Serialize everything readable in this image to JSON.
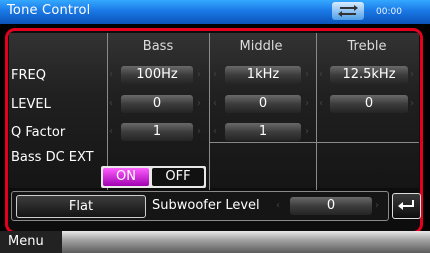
{
  "window": {
    "title": "Tone Control",
    "clock": "00:00"
  },
  "columns": [
    "Bass",
    "Middle",
    "Treble"
  ],
  "rows": [
    {
      "label": "FREQ",
      "values": [
        "100Hz",
        "1kHz",
        "12.5kHz"
      ]
    },
    {
      "label": "LEVEL",
      "values": [
        "0",
        "0",
        "0"
      ]
    },
    {
      "label": "Q Factor",
      "values": [
        "1",
        "1",
        null
      ]
    }
  ],
  "bass_dc_ext": {
    "label": "Bass DC EXT",
    "on_label": "ON",
    "off_label": "OFF",
    "selected": "ON"
  },
  "flat_button": "Flat",
  "subwoofer": {
    "label": "Subwoofer Level",
    "value": "0"
  },
  "menu": {
    "label": "Menu"
  },
  "colors": {
    "accent_red": "#e5001e",
    "title_blue": "#1a79e6",
    "on_magenta": "#d22ee0"
  }
}
